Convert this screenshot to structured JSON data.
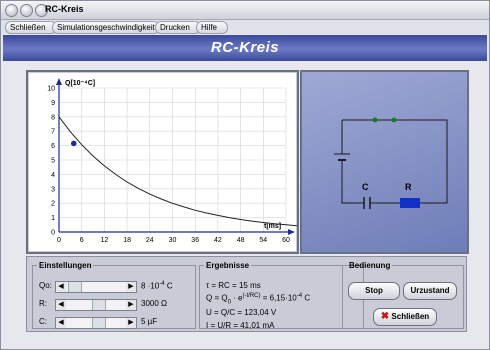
{
  "window": {
    "title": "RC-Kreis"
  },
  "menu": [
    "Schließen",
    "Simulationsgeschwindigkeit",
    "Drucken",
    "Hilfe"
  ],
  "header": {
    "title": "RC-Kreis"
  },
  "chart_data": {
    "type": "line",
    "ylabel": "Q[10⁻⁴C]",
    "xlabel": "t[ms]",
    "xlim": [
      0,
      60
    ],
    "ylim": [
      0,
      10
    ],
    "x_ticks": [
      "0",
      "6",
      "12",
      "18",
      "24",
      "30",
      "36",
      "42",
      "48",
      "54",
      "60"
    ],
    "y_ticks": [
      "0",
      "1",
      "2",
      "3",
      "4",
      "5",
      "6",
      "7",
      "8",
      "9",
      "10"
    ],
    "grid": true,
    "series": [
      {
        "values": [
          [
            0,
            8.0
          ],
          [
            3,
            6.96
          ],
          [
            6,
            6.06
          ],
          [
            9,
            5.28
          ],
          [
            12,
            4.59
          ],
          [
            15,
            3.99
          ],
          [
            18,
            3.47
          ],
          [
            21,
            3.03
          ],
          [
            24,
            2.63
          ],
          [
            27,
            2.29
          ],
          [
            30,
            1.99
          ],
          [
            33,
            1.74
          ],
          [
            36,
            1.51
          ],
          [
            39,
            1.32
          ],
          [
            42,
            1.15
          ],
          [
            45,
            1.0
          ],
          [
            48,
            0.87
          ],
          [
            51,
            0.76
          ],
          [
            54,
            0.66
          ],
          [
            57,
            0.57
          ],
          [
            60,
            0.5
          ],
          [
            63,
            0.43
          ]
        ]
      }
    ],
    "marker": {
      "x": 3.9,
      "y": 6.15
    }
  },
  "circuit": {
    "label_c": "C",
    "label_r": "R",
    "colors": {
      "resistor": "#1030c8",
      "wire": "#1a1a1a",
      "node": "#1d7a2a"
    }
  },
  "settings": {
    "legend": "Einstellungen",
    "q0": {
      "label": "Qo:",
      "value": "8",
      "unit_pre": "·10",
      "exp": "-4",
      "unit": "C",
      "level": 0.05
    },
    "r": {
      "label": "R:",
      "value": "3000 Ω",
      "level": 0.55
    },
    "c": {
      "label": "C:",
      "value": "5 µF",
      "level": 0.55
    }
  },
  "results": {
    "legend": "Ergebnisse",
    "line1": "τ = RC   = 15 ms",
    "line2_a": "Q = Q",
    "line2_b": "0",
    "line2_c": "· e",
    "line2_exp": "(-t/RC)",
    "line2_d": "= 6,15·10",
    "line2_exp2": "-4",
    "line2_e": "C",
    "line3": "U = Q/C = 123,04 V",
    "line4": "I = U/R   = 41,01 mA"
  },
  "controls": {
    "legend": "Bedienung",
    "stop": "Stop",
    "reset": "Urzustand",
    "close": "Schließen"
  }
}
